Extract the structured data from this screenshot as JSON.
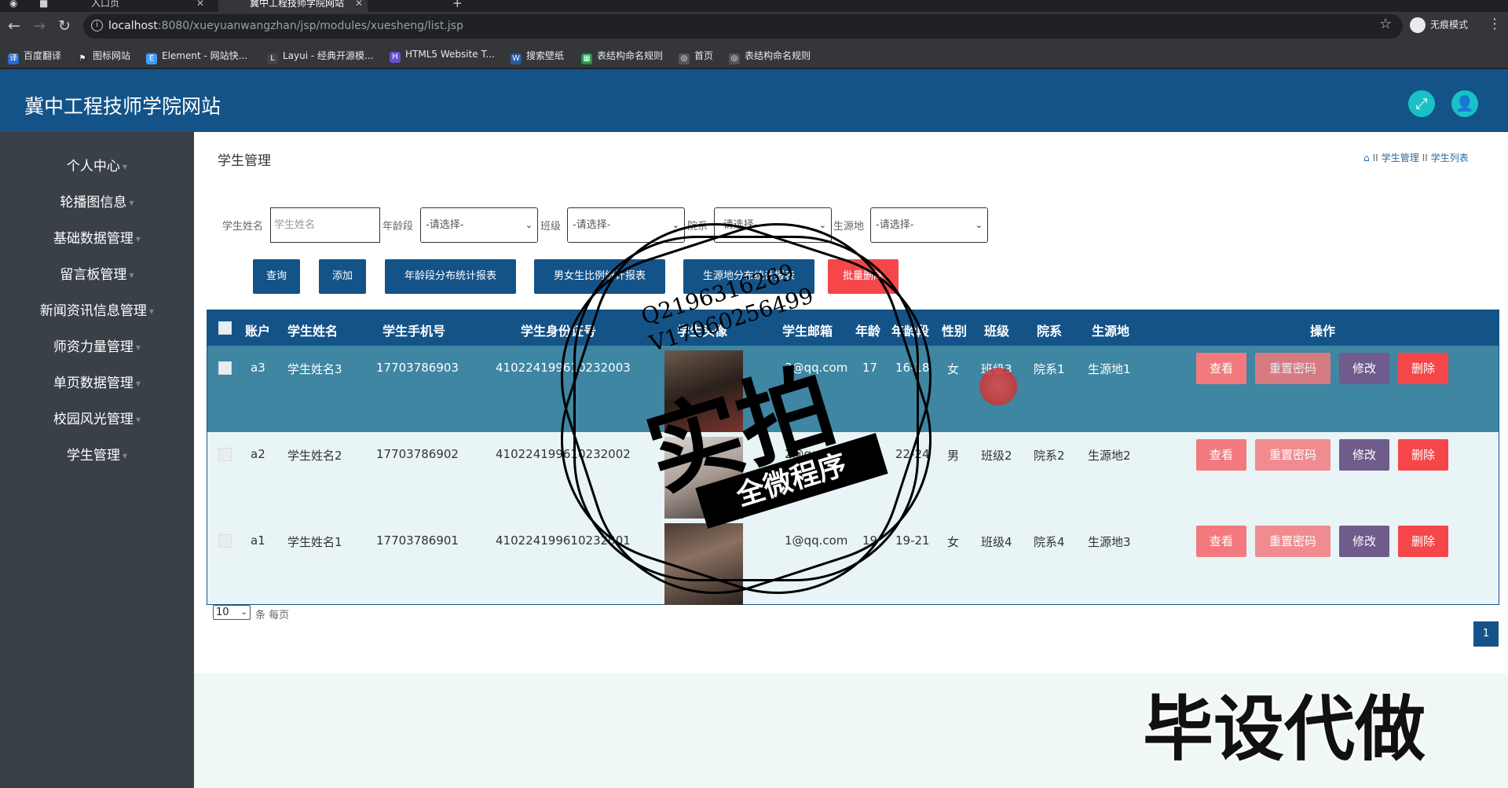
{
  "browser": {
    "tabs": [
      {
        "label": ""
      },
      {
        "label": ""
      },
      {
        "label": "入口页"
      },
      {
        "label": "冀中工程技师学院网站"
      }
    ],
    "new_tab": "+",
    "url_host": "localhost",
    "url_rest": ":8080/xueyuanwangzhan/jsp/modules/xuesheng/list.jsp",
    "incognito_label": "无痕模式",
    "bookmarks": [
      {
        "label": "百度翻译",
        "color": "#2a6ad0"
      },
      {
        "label": "图标网站",
        "color": "#333333"
      },
      {
        "label": "Element - 网站快...",
        "color": "#409eff"
      },
      {
        "label": "Layui - 经典开源模...",
        "color": "#444444"
      },
      {
        "label": "HTML5 Website T...",
        "color": "#6a4fd0"
      },
      {
        "label": "搜索壁纸",
        "color": "#2a5aa0"
      },
      {
        "label": "表结构命名规则",
        "color": "#1f9a4a"
      },
      {
        "label": "首页",
        "color": "#555555"
      },
      {
        "label": "表结构命名规则",
        "color": "#555555"
      }
    ]
  },
  "header": {
    "site_title": "冀中工程技师学院网站",
    "fullscreen_icon": "expand-icon",
    "user_icon": "user-icon"
  },
  "sidebar": {
    "items": [
      {
        "label": "个人中心"
      },
      {
        "label": "轮播图信息"
      },
      {
        "label": "基础数据管理"
      },
      {
        "label": "留言板管理"
      },
      {
        "label": "新闻资讯信息管理"
      },
      {
        "label": "师资力量管理"
      },
      {
        "label": "单页数据管理"
      },
      {
        "label": "校园风光管理"
      },
      {
        "label": "学生管理"
      }
    ]
  },
  "main": {
    "title": "学生管理",
    "breadcrumb": [
      "学生管理",
      "学生列表"
    ],
    "search": {
      "name_label": "学生姓名",
      "name_placeholder": "学生姓名",
      "age_label": "年龄段",
      "class_label": "班级",
      "dept_label": "院系",
      "origin_label": "生源地",
      "select_default": "-请选择-"
    },
    "buttons": {
      "query": "查询",
      "add": "添加",
      "age_report": "年龄段分布统计报表",
      "gender_report": "男女生比例统计报表",
      "origin_report": "生源地分布统计报表",
      "batch_delete": "批量删除"
    },
    "table": {
      "headers": [
        "账户",
        "学生姓名",
        "学生手机号",
        "学生身份证号",
        "学生头像",
        "学生邮箱",
        "年龄",
        "年龄段",
        "性别",
        "班级",
        "院系",
        "生源地",
        "操作"
      ],
      "rows": [
        {
          "account": "a3",
          "name": "学生姓名3",
          "phone": "17703786903",
          "idcard": "410224199610232003",
          "email": "3@qq.com",
          "age": "17",
          "age_range": "16-18",
          "gender": "女",
          "class": "班级3",
          "dept": "院系1",
          "origin": "生源地1"
        },
        {
          "account": "a2",
          "name": "学生姓名2",
          "phone": "17703786902",
          "idcard": "410224199610232002",
          "email": "2@qq.com",
          "age": "24",
          "age_range": "22-24",
          "gender": "男",
          "class": "班级2",
          "dept": "院系2",
          "origin": "生源地2"
        },
        {
          "account": "a1",
          "name": "学生姓名1",
          "phone": "17703786901",
          "idcard": "410224199610232001",
          "email": "1@qq.com",
          "age": "19",
          "age_range": "19-21",
          "gender": "女",
          "class": "班级4",
          "dept": "院系4",
          "origin": "生源地3"
        }
      ],
      "actions": {
        "view": "查看",
        "reset": "重置密码",
        "edit": "修改",
        "delete": "删除"
      }
    },
    "pager": {
      "page_size": "10",
      "per_page_text": "条 每页",
      "current_page": "1"
    }
  },
  "watermark": {
    "contact": "Q2196316269\nV17060256499",
    "big": "实拍",
    "band": "全微程序",
    "corner": "毕设代做"
  }
}
